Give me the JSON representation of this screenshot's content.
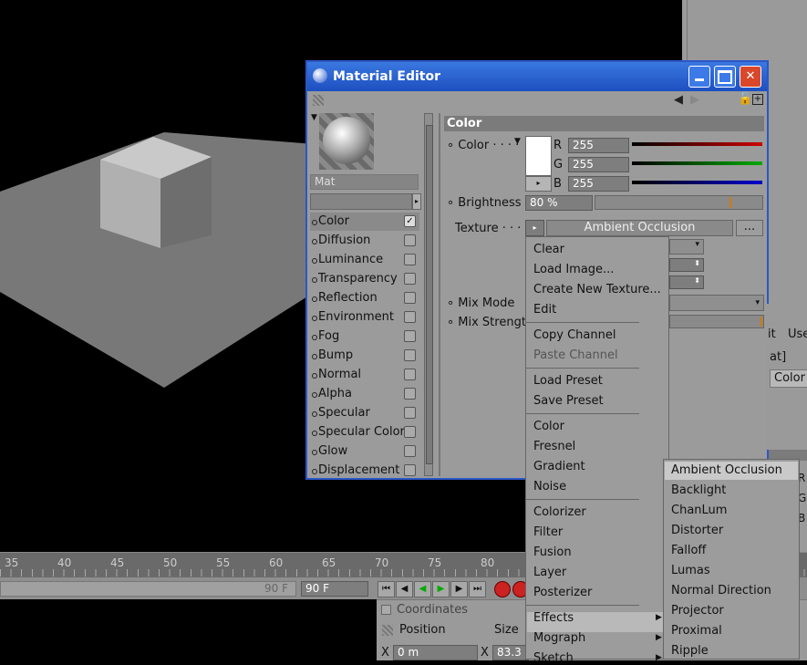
{
  "window": {
    "title": "Material Editor"
  },
  "material": {
    "name": "Mat"
  },
  "sidebar": {
    "items": [
      {
        "label": "Color",
        "checked": true
      },
      {
        "label": "Diffusion",
        "checked": false
      },
      {
        "label": "Luminance",
        "checked": false
      },
      {
        "label": "Transparency",
        "checked": false
      },
      {
        "label": "Reflection",
        "checked": false
      },
      {
        "label": "Environment",
        "checked": false
      },
      {
        "label": "Fog",
        "checked": false
      },
      {
        "label": "Bump",
        "checked": false
      },
      {
        "label": "Normal",
        "checked": false
      },
      {
        "label": "Alpha",
        "checked": false
      },
      {
        "label": "Specular",
        "checked": false
      },
      {
        "label": "Specular Color",
        "checked": false
      },
      {
        "label": "Glow",
        "checked": false
      },
      {
        "label": "Displacement",
        "checked": false
      }
    ]
  },
  "color_panel": {
    "header": "Color",
    "color_label": "Color",
    "r_label": "R",
    "r_value": "255",
    "g_label": "G",
    "g_value": "255",
    "b_label": "B",
    "b_value": "255",
    "brightness_label": "Brightness",
    "brightness_value": "80 %",
    "texture_label": "Texture",
    "texture_value": "Ambient Occlusion",
    "texture_more": "...",
    "mix_mode_label": "Mix Mode",
    "mix_strength_label": "Mix Strength"
  },
  "context_menu": {
    "items": [
      "Clear",
      "Load Image...",
      "Create New Texture...",
      "Edit",
      "Copy Channel",
      "Paste Channel",
      "Load Preset",
      "Save Preset",
      "Color",
      "Fresnel",
      "Gradient",
      "Noise",
      "Colorizer",
      "Filter",
      "Fusion",
      "Layer",
      "Posterizer",
      "Effects",
      "Mograph",
      "Sketch"
    ]
  },
  "effects_submenu": {
    "items": [
      "Ambient Occlusion",
      "Backlight",
      "ChanLum",
      "Distorter",
      "Falloff",
      "Lumas",
      "Normal Direction",
      "Projector",
      "Proximal",
      "Ripple"
    ]
  },
  "timeline": {
    "ticks": [
      "35",
      "40",
      "45",
      "50",
      "55",
      "60",
      "65",
      "70",
      "75",
      "80"
    ],
    "end_field": "90 F",
    "end_value": "90 F"
  },
  "coordinates": {
    "title": "Coordinates",
    "position_label": "Position",
    "size_label": "Size",
    "x_label": "X",
    "x_value": "0 m",
    "size_x": "83.3"
  },
  "right_fragments": {
    "it": "it",
    "use": "Use",
    "mat": "at]",
    "color": "Color",
    "r": "R",
    "g": "G",
    "b": "B"
  },
  "colors": {
    "accent": "#2b56c7",
    "red": "#cc0000",
    "green": "#00aa00",
    "blue": "#0000cc"
  }
}
